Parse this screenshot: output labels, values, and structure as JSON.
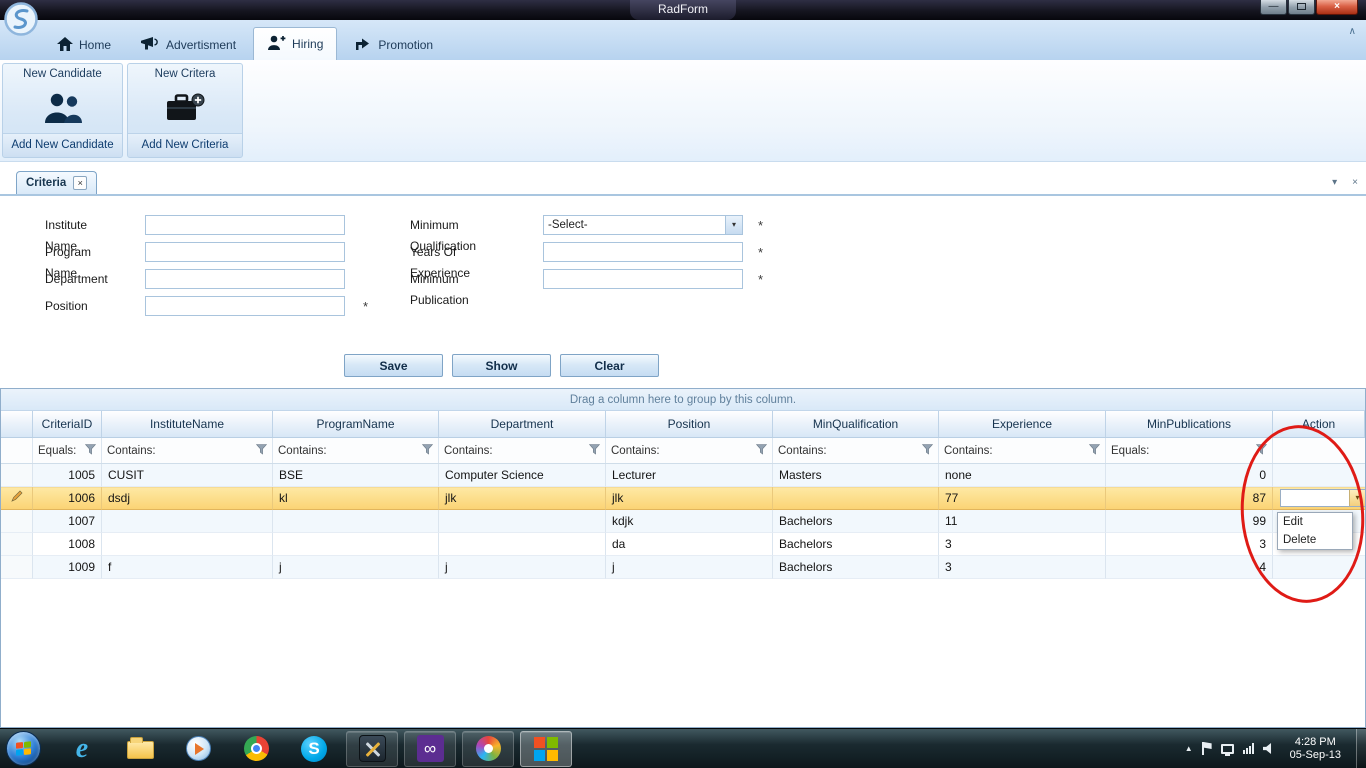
{
  "window": {
    "title": "RadForm"
  },
  "icons": {
    "close": "×",
    "minimize": "—",
    "dropdown": "▾",
    "collapse": "∧",
    "up_arrow": "▲",
    "skype_glyph": "S",
    "ie_glyph": "e",
    "vs_glyph": "∞"
  },
  "ribbon": {
    "tabs": [
      {
        "label": "Home"
      },
      {
        "label": "Advertisment"
      },
      {
        "label": "Hiring"
      },
      {
        "label": "Promotion"
      }
    ],
    "groups": [
      {
        "title": "New Candidate",
        "button": "Add New Candidate"
      },
      {
        "title": "New Critera",
        "button": "Add New Criteria"
      }
    ]
  },
  "doc_tab": {
    "label": "Criteria"
  },
  "form": {
    "left_fields": [
      {
        "label": "Institute Name",
        "value": ""
      },
      {
        "label": "Program Name",
        "value": ""
      },
      {
        "label": "Department",
        "value": ""
      },
      {
        "label": "Position",
        "value": ""
      }
    ],
    "right_fields": [
      {
        "label": "Minimum Qualification",
        "value": "-Select-"
      },
      {
        "label": "Years Of Experience",
        "value": ""
      },
      {
        "label": "Minimum Publication",
        "value": ""
      }
    ],
    "required_marker": "*",
    "buttons": [
      "Save",
      "Show",
      "Clear"
    ]
  },
  "grid": {
    "group_hint": "Drag a column here to group by this column.",
    "columns": [
      "CriteriaID",
      "InstituteName",
      "ProgramName",
      "Department",
      "Position",
      "MinQualification",
      "Experience",
      "MinPublications",
      "Action"
    ],
    "filters": [
      "Equals:",
      "Contains:",
      "Contains:",
      "Contains:",
      "Contains:",
      "Contains:",
      "Contains:",
      "Equals:"
    ],
    "rows": [
      {
        "cells": [
          "1005",
          "CUSIT",
          "BSE",
          "Computer Science",
          "Lecturer",
          "Masters",
          "none",
          "0"
        ]
      },
      {
        "cells": [
          "1006",
          "dsdj",
          "kl",
          "jlk",
          "jlk",
          "",
          "77",
          "87"
        ]
      },
      {
        "cells": [
          "1007",
          "",
          "",
          "",
          "kdjk",
          "Bachelors",
          "11",
          "99"
        ]
      },
      {
        "cells": [
          "1008",
          "",
          "",
          "",
          "da",
          "Bachelors",
          "3",
          "3"
        ]
      },
      {
        "cells": [
          "1009",
          "f",
          "j",
          "j",
          "j",
          "Bachelors",
          "3",
          "4"
        ]
      }
    ],
    "action_menu": {
      "items": [
        "Edit",
        "Delete"
      ]
    }
  },
  "taskbar": {
    "clock": {
      "time": "4:28 PM",
      "date": "05-Sep-13"
    }
  }
}
